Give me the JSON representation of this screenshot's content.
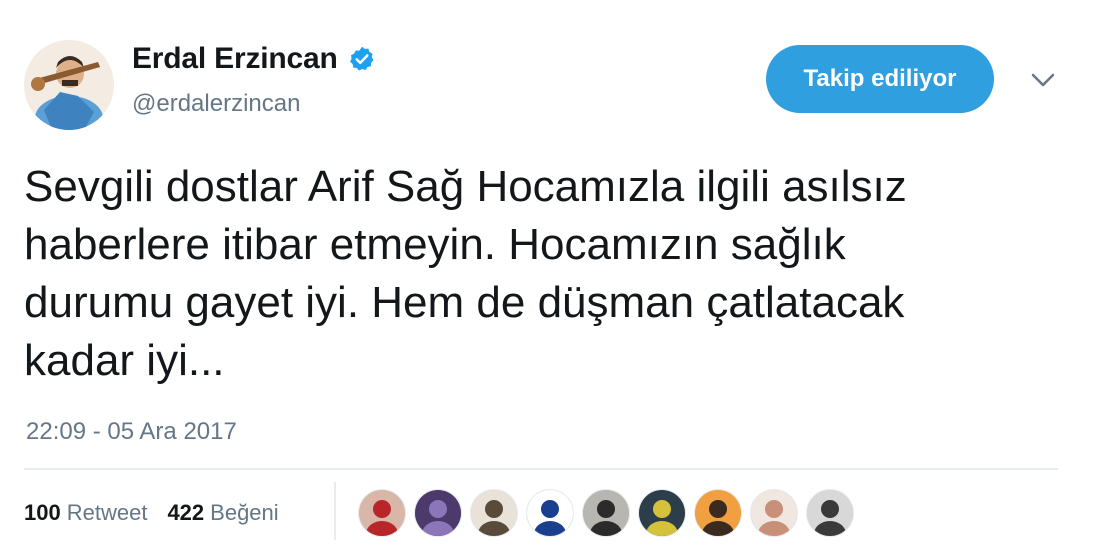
{
  "user": {
    "display_name": "Erdal Erzincan",
    "handle": "@erdalerzincan",
    "verified_icon": "verified-badge-icon",
    "avatar_icon": "avatar"
  },
  "follow_button": {
    "label": "Takip ediliyor",
    "color": "#2f9fe0"
  },
  "menu_icon": "chevron-down-icon",
  "tweet": {
    "lines": [
      "Sevgili dostlar Arif Sağ Hocamızla ilgili asılsız",
      "haberlere itibar etmeyin. Hocamızın sağlık",
      "durumu gayet iyi. Hem de düşman çatlatacak",
      "kadar iyi..."
    ],
    "timestamp": "22:09 - 05 Ara 2017"
  },
  "stats": {
    "retweet_count": "100",
    "retweet_label": "Retweet",
    "like_count": "422",
    "like_label": "Beğeni"
  },
  "likers": [
    {
      "name": "liker-avatar-1",
      "bg": "#d9b7a8",
      "fg": "#b8262a"
    },
    {
      "name": "liker-avatar-2",
      "bg": "#4b3a6b",
      "fg": "#8a76b8"
    },
    {
      "name": "liker-avatar-3",
      "bg": "#e8e2d8",
      "fg": "#5a4a3a"
    },
    {
      "name": "liker-avatar-4",
      "bg": "#ffffff",
      "fg": "#1b3f8f"
    },
    {
      "name": "liker-avatar-5",
      "bg": "#b7b6b0",
      "fg": "#2b2b2b"
    },
    {
      "name": "liker-avatar-6",
      "bg": "#2c3e4a",
      "fg": "#d6c23a"
    },
    {
      "name": "liker-avatar-7",
      "bg": "#f0a040",
      "fg": "#3a2a20"
    },
    {
      "name": "liker-avatar-8",
      "bg": "#efe7e0",
      "fg": "#c89078"
    },
    {
      "name": "liker-avatar-9",
      "bg": "#d8d8d8",
      "fg": "#3a3a3a"
    }
  ],
  "colors": {
    "text": "#14171a",
    "secondary": "#657786",
    "divider": "#e6ecf0",
    "accent": "#1da1f2"
  }
}
